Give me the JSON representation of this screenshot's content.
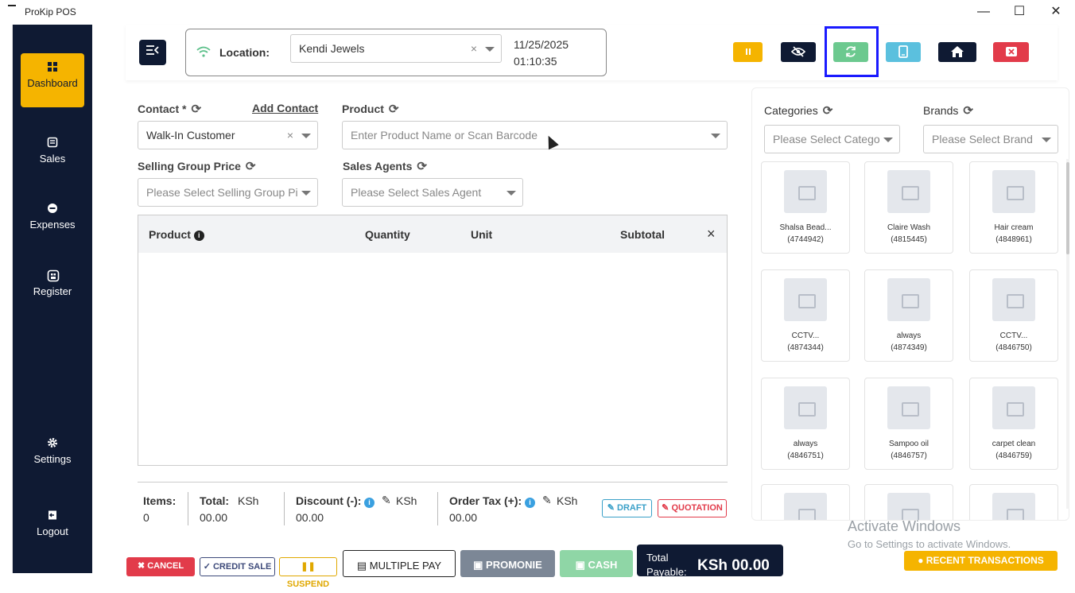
{
  "window": {
    "title": "ProKip POS",
    "minimize": "—",
    "maximize": "☐",
    "close": "✕"
  },
  "sidebar": {
    "items": [
      {
        "label": "Dashboard",
        "icon": "grid-icon"
      },
      {
        "label": "Sales",
        "icon": "receipt-icon"
      },
      {
        "label": "Expenses",
        "icon": "minus-circle-icon"
      },
      {
        "label": "Register",
        "icon": "store-icon"
      },
      {
        "label": "Settings",
        "icon": "gear-icon"
      },
      {
        "label": "Logout",
        "icon": "logout-icon"
      }
    ]
  },
  "header": {
    "location_label": "Location:",
    "location_value": "Kendi Jewels",
    "date": "11/25/2025",
    "time": "01:10:35",
    "buttons": [
      {
        "name": "pause",
        "color": "#f5b400"
      },
      {
        "name": "hide",
        "color": "#0f1a33"
      },
      {
        "name": "refresh",
        "color": "#6cc98f"
      },
      {
        "name": "tablet",
        "color": "#5bc0de"
      },
      {
        "name": "home",
        "color": "#0f1a33"
      },
      {
        "name": "close",
        "color": "#e23b4a"
      }
    ]
  },
  "form": {
    "contact_label": "Contact *",
    "add_contact": "Add Contact",
    "contact_value": "Walk-In Customer",
    "product_label": "Product",
    "product_placeholder": "Enter Product Name or Scan Barcode",
    "selling_group_label": "Selling Group Price",
    "selling_group_placeholder": "Please Select Selling Group Pi",
    "sales_agents_label": "Sales Agents",
    "sales_agents_placeholder": "Please Select Sales Agent"
  },
  "cart": {
    "columns": [
      "Product",
      "Quantity",
      "Unit",
      "Subtotal"
    ],
    "remove": "×",
    "rows": []
  },
  "totals": {
    "items_label": "Items:",
    "items_value": "0",
    "total_label": "Total:",
    "total_currency": "KSh",
    "total_value": "00.00",
    "discount_label": "Discount (-):",
    "discount_currency": "KSh",
    "discount_value": "00.00",
    "tax_label": "Order Tax (+):",
    "tax_currency": "KSh",
    "tax_value": "00.00"
  },
  "actions": {
    "draft": "DRAFT",
    "quotation": "QUOTATION",
    "cancel": "CANCEL",
    "credit_sale": "CREDIT SALE",
    "suspend": "SUSPEND",
    "multiple_pay": "MULTIPLE PAY",
    "promonie": "PROMONIE",
    "cash": "CASH",
    "total_payable_label_1": "Total",
    "total_payable_label_2": "Payable:",
    "total_payable": "KSh 00.00"
  },
  "right_panel": {
    "categories_label": "Categories",
    "categories_placeholder": "Please Select Catego",
    "brands_label": "Brands",
    "brands_placeholder": "Please Select Brand",
    "products": [
      {
        "name": "Shalsa Bead...",
        "code": "(4744942)"
      },
      {
        "name": "Claire Wash",
        "code": "(4815445)"
      },
      {
        "name": "Hair cream",
        "code": "(4848961)"
      },
      {
        "name": "CCTV...",
        "code": "(4874344)"
      },
      {
        "name": "always",
        "code": "(4874349)"
      },
      {
        "name": "CCTV...",
        "code": "(4846750)"
      },
      {
        "name": "always",
        "code": "(4846751)"
      },
      {
        "name": "Sampoo oil",
        "code": "(4846757)"
      },
      {
        "name": "carpet clean",
        "code": "(4846759)"
      }
    ],
    "recent_transactions": "RECENT TRANSACTIONS"
  },
  "watermark": {
    "line1": "Activate Windows",
    "line2": "Go to Settings to activate Windows."
  }
}
